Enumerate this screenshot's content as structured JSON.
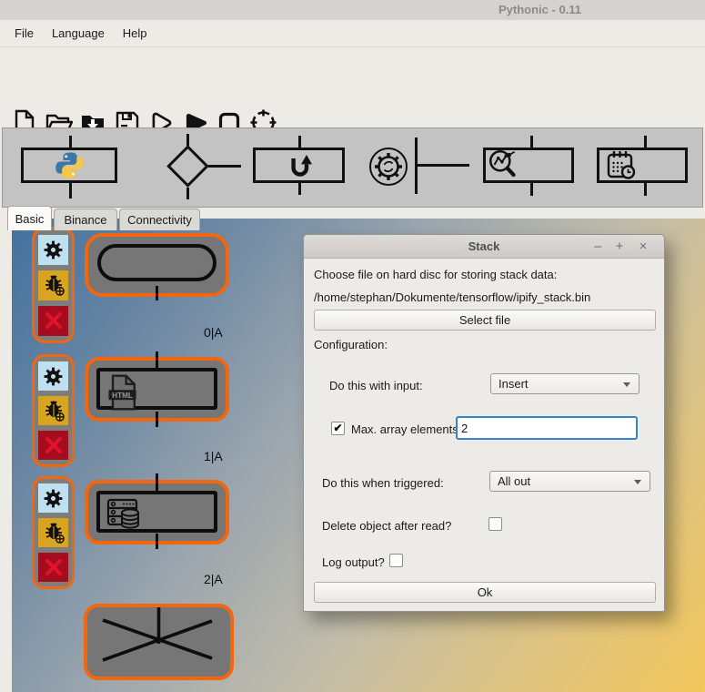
{
  "window": {
    "title": "Pythonic - 0.11"
  },
  "menubar": {
    "items": [
      {
        "label": "File"
      },
      {
        "label": "Language"
      },
      {
        "label": "Help"
      }
    ]
  },
  "toolbar": {
    "buttons": [
      "new-file",
      "open-file",
      "save-as",
      "save",
      "run-debug",
      "play",
      "stop",
      "kill"
    ]
  },
  "tabs": [
    {
      "label": "Basic",
      "active": true
    },
    {
      "label": "Binance",
      "active": false
    },
    {
      "label": "Connectivity",
      "active": false
    }
  ],
  "toolbox": {
    "elements": [
      "python-execution",
      "branch",
      "return",
      "process",
      "generic-pipeline",
      "scheduler"
    ]
  },
  "canvas": {
    "groups": [
      {
        "type": "start-element",
        "label": "0|A",
        "tools": [
          "settings",
          "debug",
          "delete"
        ]
      },
      {
        "type": "html-element",
        "label": "1|A",
        "tools": [
          "settings",
          "debug",
          "delete"
        ]
      },
      {
        "type": "server-element",
        "label": "2|A",
        "tools": [
          "settings",
          "debug",
          "delete"
        ]
      },
      {
        "type": "junction-element",
        "label": ""
      }
    ],
    "html_badge": "HTML"
  },
  "dialog": {
    "title": "Stack",
    "choose_file_label": "Choose file on hard disc for storing stack data:",
    "file_path": "/home/stephan/Dokumente/tensorflow/ipify_stack.bin",
    "select_file_button": "Select file",
    "configuration_label": "Configuration:",
    "input_mode": {
      "label": "Do this with input:",
      "value": "Insert"
    },
    "max_elements": {
      "label": "Max. array elements:",
      "checked": true,
      "value": "2"
    },
    "trigger_mode": {
      "label": "Do this when triggered:",
      "value": "All out"
    },
    "delete_after_read": {
      "label": "Delete object after read?",
      "checked": false
    },
    "log_output": {
      "label": "Log output?",
      "checked": false
    },
    "ok_button": "Ok"
  },
  "icons": {
    "checkmark": "✔",
    "minimize": "–",
    "maximize": "+",
    "close": "×"
  },
  "colors": {
    "element_border": "#f2670e",
    "element_fill": "#767676",
    "settings_button_bg": "#bfe0ee",
    "debug_button_bg": "#d9a520",
    "delete_button_bg": "#a50d1e",
    "delete_x": "#e0132b",
    "focus_border": "#3584c4",
    "canvas_gradient_top_left": "#44719f",
    "canvas_gradient_bottom_right": "#f2c75b"
  }
}
